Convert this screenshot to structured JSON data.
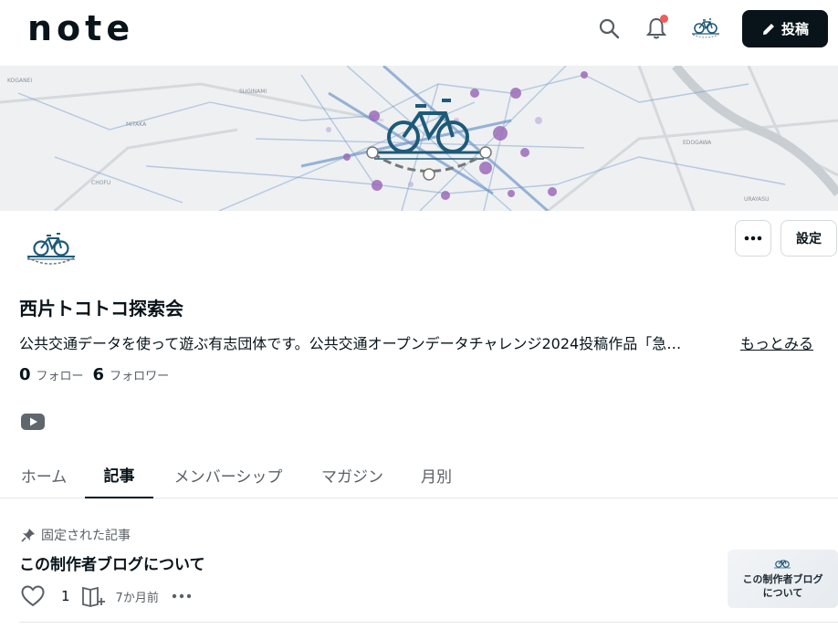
{
  "header": {
    "logo_text": "note",
    "search_icon": "search-icon",
    "bell_icon": "bell-icon",
    "post_label": "投稿",
    "post_icon": "pencil-icon"
  },
  "banner": {
    "map_labels": [
      "KOGANEI",
      "SUGINAMI",
      "MITAKA",
      "CHOFU",
      "EDOGAWA",
      "URAYASU"
    ],
    "icon": "bicycle-icon"
  },
  "profile": {
    "name": "西片トコトコ探索会",
    "description": "公共交通データを使って遊ぶ有志団体です。公共交通オープンデータチャレンジ2024投稿作品「急…",
    "more_link": "もっとみる",
    "follow_count": "0",
    "follow_label": "フォロー",
    "follower_count": "6",
    "follower_label": "フォロワー",
    "more_button_icon": "more-dots-icon",
    "settings_label": "設定",
    "social_icon": "youtube-icon"
  },
  "tabs": [
    {
      "label": "ホーム",
      "active": false
    },
    {
      "label": "記事",
      "active": true
    },
    {
      "label": "メンバーシップ",
      "active": false
    },
    {
      "label": "マガジン",
      "active": false
    },
    {
      "label": "月別",
      "active": false
    }
  ],
  "article": {
    "pinned_label": "固定された記事",
    "title": "この制作者ブログについて",
    "like_count": "1",
    "time": "7か月前",
    "thumbnail_text_line1": "この制作者ブログ",
    "thumbnail_text_line2": "について"
  },
  "colors": {
    "primary": "#08131a",
    "notification_dot": "#f15b5b",
    "bike_teal": "#1d5a78",
    "map_node_purple": "#9b6bb8",
    "map_edge_blue": "#6f97c9"
  }
}
